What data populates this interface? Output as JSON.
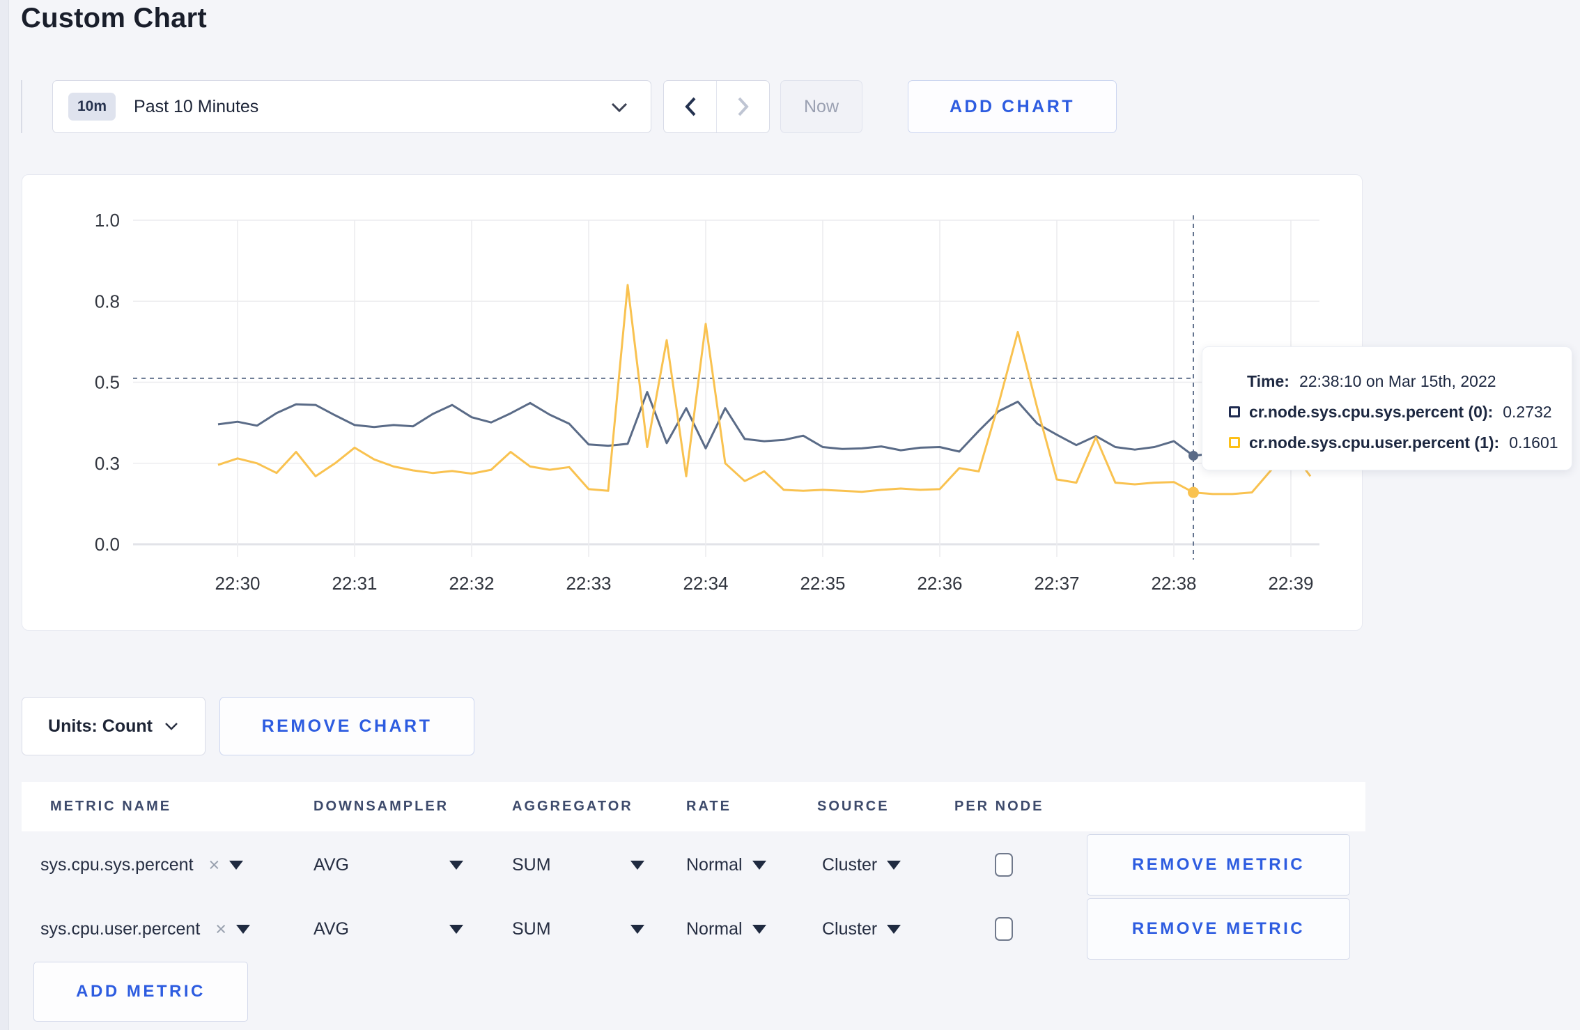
{
  "page": {
    "title": "Custom Chart"
  },
  "toolbar": {
    "time_window_badge": "10m",
    "time_window_label": "Past 10 Minutes",
    "now_label": "Now",
    "add_chart_label": "ADD CHART"
  },
  "chart_footer": {
    "units_label": "Units: Count",
    "remove_chart_label": "REMOVE CHART"
  },
  "tooltip": {
    "time_label": "Time:",
    "time_value": "22:38:10 on Mar 15th, 2022",
    "rows": [
      {
        "label": "cr.node.sys.cpu.sys.percent (0):",
        "value": "0.2732",
        "color": "#1f2b50"
      },
      {
        "label": "cr.node.sys.cpu.user.percent (1):",
        "value": "0.1601",
        "color": "#fdc018"
      }
    ]
  },
  "chart_data": {
    "type": "line",
    "x_unit": "time",
    "x_start": "22:29:50",
    "x_interval_seconds": 10,
    "xtick_labels": [
      "22:30",
      "22:31",
      "22:32",
      "22:33",
      "22:34",
      "22:35",
      "22:36",
      "22:37",
      "22:38",
      "22:39"
    ],
    "ytick_values": [
      0,
      0.25,
      0.5,
      0.75,
      1
    ],
    "ytick_labels": [
      "0.0",
      "0.3",
      "0.5",
      "0.8",
      "1.0"
    ],
    "ylim": [
      0,
      1
    ],
    "grid": true,
    "legend_position": "tooltip",
    "series": [
      {
        "name": "cr.node.sys.cpu.sys.percent",
        "color": "#5a6b87",
        "values": [
          0.37,
          0.378,
          0.366,
          0.405,
          0.432,
          0.43,
          0.398,
          0.368,
          0.362,
          0.368,
          0.364,
          0.402,
          0.43,
          0.392,
          0.376,
          0.404,
          0.436,
          0.4,
          0.372,
          0.308,
          0.304,
          0.31,
          0.47,
          0.312,
          0.42,
          0.296,
          0.42,
          0.325,
          0.318,
          0.322,
          0.335,
          0.3,
          0.294,
          0.296,
          0.302,
          0.29,
          0.298,
          0.3,
          0.286,
          0.35,
          0.41,
          0.44,
          0.372,
          0.338,
          0.306,
          0.334,
          0.3,
          0.292,
          0.3,
          0.318,
          0.2732,
          0.28,
          0.272,
          0.296,
          0.282,
          0.286,
          0.28
        ]
      },
      {
        "name": "cr.node.sys.cpu.user.percent",
        "color": "#f9c250",
        "values": [
          0.245,
          0.265,
          0.25,
          0.22,
          0.285,
          0.21,
          0.25,
          0.298,
          0.262,
          0.24,
          0.228,
          0.22,
          0.226,
          0.218,
          0.23,
          0.285,
          0.24,
          0.23,
          0.238,
          0.17,
          0.165,
          0.8,
          0.3,
          0.63,
          0.21,
          0.68,
          0.25,
          0.195,
          0.225,
          0.168,
          0.165,
          0.168,
          0.165,
          0.162,
          0.168,
          0.172,
          0.168,
          0.17,
          0.235,
          0.225,
          0.43,
          0.655,
          0.42,
          0.2,
          0.19,
          0.33,
          0.19,
          0.185,
          0.19,
          0.192,
          0.1601,
          0.155,
          0.155,
          0.16,
          0.23,
          0.29,
          0.21
        ]
      }
    ],
    "crosshair": {
      "time": "22:38:10",
      "x_offset_minutes": 8.1667,
      "hline_value": 0.512,
      "sys_value": 0.2732,
      "user_value": 0.1601
    }
  },
  "metrics_table": {
    "headers": [
      "METRIC NAME",
      "DOWNSAMPLER",
      "AGGREGATOR",
      "RATE",
      "SOURCE",
      "PER NODE"
    ],
    "rows": [
      {
        "metric": "sys.cpu.sys.percent",
        "remove_icon": "×",
        "downsampler": "AVG",
        "aggregator": "SUM",
        "rate": "Normal",
        "source": "Cluster",
        "per_node_checked": false,
        "remove_label": "REMOVE METRIC"
      },
      {
        "metric": "sys.cpu.user.percent",
        "remove_icon": "×",
        "downsampler": "AVG",
        "aggregator": "SUM",
        "rate": "Normal",
        "source": "Cluster",
        "per_node_checked": false,
        "remove_label": "REMOVE METRIC"
      }
    ],
    "add_metric_label": "ADD METRIC"
  }
}
